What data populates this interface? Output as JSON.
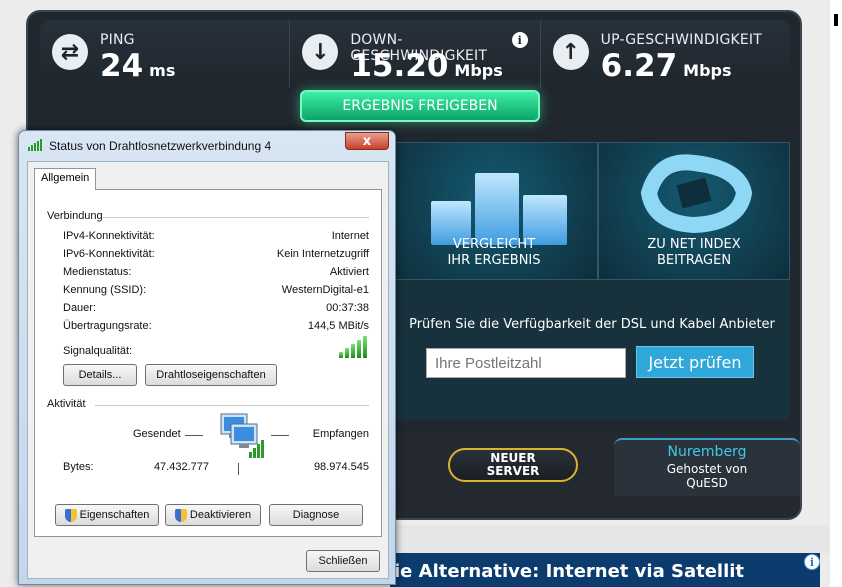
{
  "speedtest": {
    "ping": {
      "label": "PING",
      "value": "24",
      "unit": "ms",
      "icon": "ping-arrows-icon"
    },
    "download": {
      "label": "DOWN-GESCHWINDIGKEIT",
      "value": "15.20",
      "unit": "Mbps",
      "icon": "download-arrow-icon",
      "info": "i"
    },
    "upload": {
      "label": "UP-GESCHWINDIGKEIT",
      "value": "6.27",
      "unit": "Mbps",
      "icon": "upload-arrow-icon"
    },
    "share_button": "ERGEBNIS FREIGEBEN",
    "tile_compare": [
      "VERGLEICHT",
      "IHR ERGEBNIS"
    ],
    "tile_netindex": [
      "ZU NET INDEX",
      "BEITRAGEN"
    ],
    "dsl_check_text": "Prüfen Sie die Verfügbarkeit der DSL und Kabel Anbieter",
    "zip_placeholder": "Ihre Postleitzahl",
    "check_button": "Jetzt prüfen",
    "new_server_button": [
      "NEUER",
      "SERVER"
    ],
    "server": {
      "city": "Nuremberg",
      "hosted_line1": "Gehostet von",
      "hosted_line2": "QuESD"
    },
    "accent_green": "#19c47f",
    "accent_blue": "#2fa7d8"
  },
  "ad": {
    "text": "ie Alternative: Internet via Satellit",
    "info": "i"
  },
  "dialog": {
    "title": "Status von Drahtlosnetzwerkverbindung 4",
    "close": "x",
    "tab": "Allgemein",
    "connection": {
      "heading": "Verbindung",
      "rows": [
        {
          "label": "IPv4-Konnektivität:",
          "value": "Internet"
        },
        {
          "label": "IPv6-Konnektivität:",
          "value": "Kein Internetzugriff"
        },
        {
          "label": "Medienstatus:",
          "value": "Aktiviert"
        },
        {
          "label": "Kennung (SSID):",
          "value": "WesternDigital-e1"
        },
        {
          "label": "Dauer:",
          "value": "00:37:38"
        },
        {
          "label": "Übertragungsrate:",
          "value": "144,5 MBit/s"
        }
      ],
      "signal_label": "Signalqualität:",
      "signal_bars": 5,
      "details_button": "Details...",
      "wireless_button": "Drahtloseigenschaften"
    },
    "activity": {
      "heading": "Aktivität",
      "sent_label": "Gesendet",
      "received_label": "Empfangen",
      "bytes_label": "Bytes:",
      "bytes_sent": "47.432.777",
      "bytes_received": "98.974.545"
    },
    "buttons": {
      "properties": "Eigenschaften",
      "deactivate": "Deaktivieren",
      "diagnose": "Diagnose",
      "close": "Schließen"
    }
  }
}
